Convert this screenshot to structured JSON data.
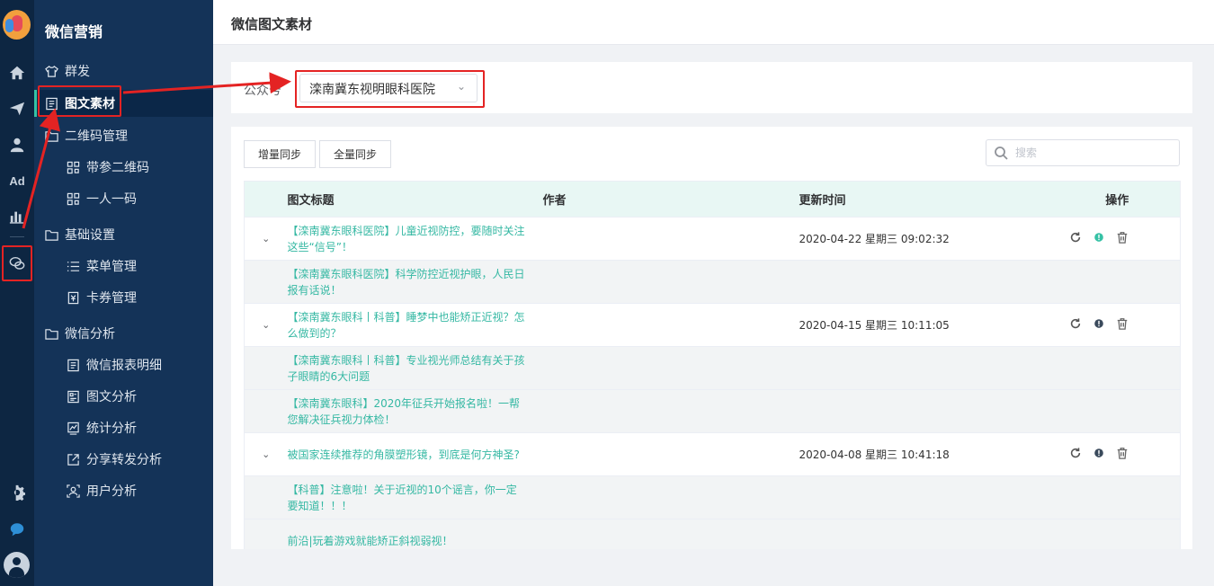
{
  "sidebar": {
    "title": "微信营销",
    "items": [
      {
        "label": "群发"
      },
      {
        "label": "图文素材"
      },
      {
        "label": "二维码管理"
      },
      {
        "label": "带参二维码"
      },
      {
        "label": "一人一码"
      },
      {
        "label": "基础设置"
      },
      {
        "label": "菜单管理"
      },
      {
        "label": "卡券管理"
      },
      {
        "label": "微信分析"
      },
      {
        "label": "微信报表明细"
      },
      {
        "label": "图文分析"
      },
      {
        "label": "统计分析"
      },
      {
        "label": "分享转发分析"
      },
      {
        "label": "用户分析"
      }
    ]
  },
  "rail": {
    "ad_label": "Ad",
    "icons": [
      "home-icon",
      "send-icon",
      "user-icon",
      "ad-icon",
      "bar-chart-icon",
      "wechat-icon",
      "gear-icon",
      "chat-icon",
      "avatar-icon"
    ]
  },
  "header": {
    "title": "微信图文素材"
  },
  "account": {
    "label": "公众号",
    "selected": "滦南冀东视明眼科医院"
  },
  "toolbar": {
    "incremental_sync": "增量同步",
    "full_sync": "全量同步",
    "search_placeholder": "搜索"
  },
  "table": {
    "headers": {
      "title": "图文标题",
      "author": "作者",
      "updated": "更新时间",
      "actions": "操作"
    },
    "groups": [
      {
        "title": "【滦南冀东眼科医院】儿童近视防控，要随时关注这些“信号”！",
        "time": "2020-04-22 星期三 09:02:32",
        "status_color": "#35c1a5",
        "subs": [
          "【滦南冀东眼科医院】科学防控近视护眼，人民日报有话说！"
        ]
      },
      {
        "title": "【滦南冀东眼科丨科普】睡梦中也能矫正近视？怎么做到的？",
        "time": "2020-04-15 星期三 10:11:05",
        "status_color": "#3a4a5c",
        "subs": [
          "【滦南冀东眼科丨科普】专业视光师总结有关于孩子眼睛的6大问题",
          "【滦南冀东眼科】2020年征兵开始报名啦！一帮您解决征兵视力体检！"
        ]
      },
      {
        "title": "被国家连续推荐的角膜塑形镜，到底是何方神圣?",
        "time": "2020-04-08 星期三 10:41:18",
        "status_color": "#3a4a5c",
        "subs": [
          "【科普】注意啦！关于近视的10个谣言，你一定要知道！！！",
          "前沿|玩着游戏就能矫正斜视弱视！"
        ]
      }
    ]
  },
  "colors": {
    "accent": "#35c1a5",
    "sidebar": "#143358",
    "rail": "#0d2642",
    "highlight": "#e42323"
  }
}
